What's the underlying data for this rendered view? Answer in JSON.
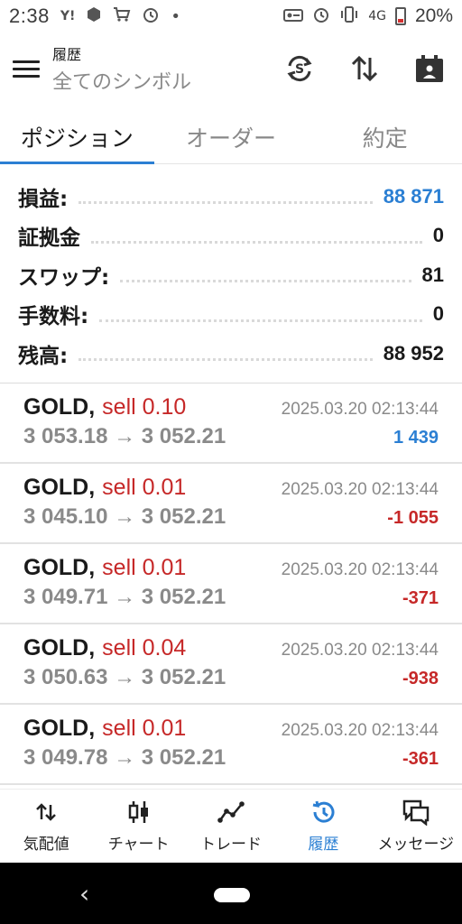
{
  "status_bar": {
    "time": "2:38",
    "left_icons": [
      "Y!",
      "cube-icon",
      "cart-icon",
      "alarm-icon",
      "•"
    ],
    "right_icons": [
      "vpn-icon",
      "alarm-icon",
      "vibrate-icon",
      "4G"
    ],
    "battery": "20%"
  },
  "header": {
    "small_title": "履歴",
    "subtitle": "全てのシンボル"
  },
  "tabs": [
    {
      "label": "ポジション",
      "active": true
    },
    {
      "label": "オーダー",
      "active": false
    },
    {
      "label": "約定",
      "active": false
    }
  ],
  "summary": [
    {
      "label": "損益:",
      "value": "88 871",
      "color": "#2b7fd3"
    },
    {
      "label": "証拠金",
      "value": "0",
      "color": "#1a1a1a"
    },
    {
      "label": "スワップ:",
      "value": "81",
      "color": "#1a1a1a"
    },
    {
      "label": "手数料:",
      "value": "0",
      "color": "#1a1a1a"
    },
    {
      "label": "残高:",
      "value": "88 952",
      "color": "#1a1a1a"
    }
  ],
  "trades": [
    {
      "symbol": "GOLD,",
      "side": "sell 0.10",
      "time": "2025.03.20 02:13:44",
      "prices": "3 053.18 → 3 052.21",
      "pl": "1 439",
      "pl_color": "#2b7fd3"
    },
    {
      "symbol": "GOLD,",
      "side": "sell 0.01",
      "time": "2025.03.20 02:13:44",
      "prices": "3 045.10 → 3 052.21",
      "pl": "-1 055",
      "pl_color": "#c62828"
    },
    {
      "symbol": "GOLD,",
      "side": "sell 0.01",
      "time": "2025.03.20 02:13:44",
      "prices": "3 049.71 → 3 052.21",
      "pl": "-371",
      "pl_color": "#c62828"
    },
    {
      "symbol": "GOLD,",
      "side": "sell 0.04",
      "time": "2025.03.20 02:13:44",
      "prices": "3 050.63 → 3 052.21",
      "pl": "-938",
      "pl_color": "#c62828"
    },
    {
      "symbol": "GOLD,",
      "side": "sell 0.01",
      "time": "2025.03.20 02:13:44",
      "prices": "3 049.78 → 3 052.21",
      "pl": "-361",
      "pl_color": "#c62828"
    }
  ],
  "bottom_nav": [
    {
      "label": "気配値",
      "icon": "quotes-icon",
      "active": false
    },
    {
      "label": "チャート",
      "icon": "chart-icon",
      "active": false
    },
    {
      "label": "トレード",
      "icon": "trade-icon",
      "active": false
    },
    {
      "label": "履歴",
      "icon": "history-icon",
      "active": true
    },
    {
      "label": "メッセージ",
      "icon": "messages-icon",
      "active": false
    }
  ],
  "colors": {
    "accent": "#2b7fd3",
    "loss": "#c62828",
    "muted": "#8a8a8a"
  }
}
